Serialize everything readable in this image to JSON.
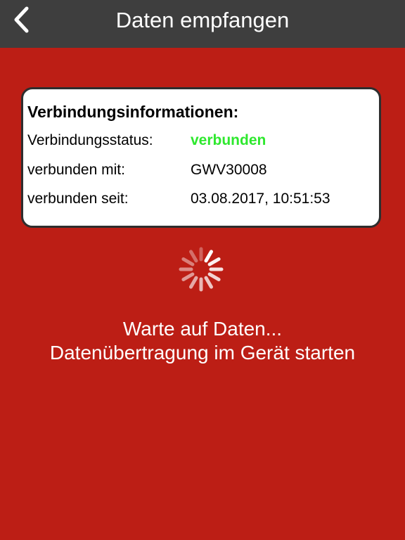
{
  "nav": {
    "title": "Daten empfangen",
    "back_icon": "chevron-left-icon"
  },
  "connection_info": {
    "heading": "Verbindungsinformationen:",
    "status_label": "Verbindungsstatus:",
    "status_value": "verbunden",
    "status_color": "#2EE82E",
    "connected_with_label": "verbunden mit:",
    "connected_with_value": "GWV30008",
    "connected_since_label": "verbunden seit:",
    "connected_since_value": "03.08.2017, 10:51:53"
  },
  "spinner_icon": "activity-spinner-icon",
  "message": {
    "line1": "Warte auf Daten...",
    "line2": "Datenübertragung im Gerät starten"
  },
  "colors": {
    "background": "#BC1E15",
    "navbar": "#3E3E3E",
    "card": "#FFFFFF",
    "card_border": "#2E2E2E"
  }
}
